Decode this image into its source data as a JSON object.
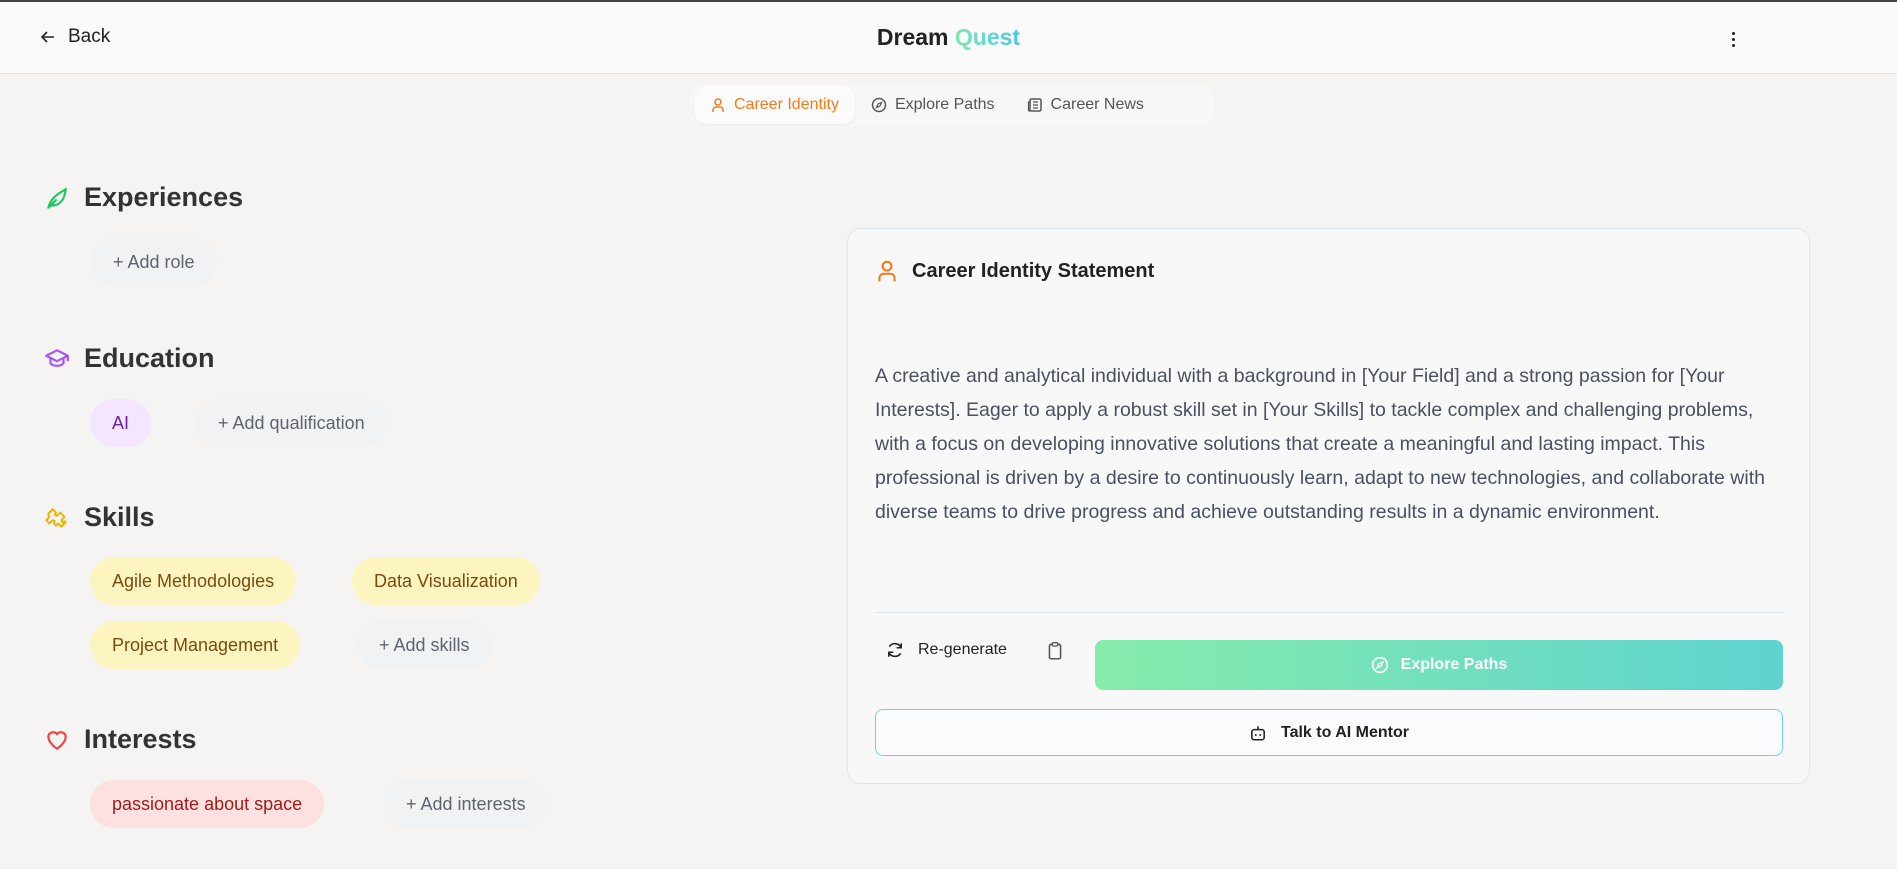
{
  "header": {
    "back_label": "Back",
    "title_part1": "Dream",
    "title_part2": "Quest"
  },
  "tabs": [
    {
      "label": "Career Identity",
      "active": true
    },
    {
      "label": "Explore Paths",
      "active": false
    },
    {
      "label": "Career News",
      "active": false
    }
  ],
  "sections": {
    "experiences": {
      "title": "Experiences",
      "items": [],
      "add_label": "+ Add role"
    },
    "education": {
      "title": "Education",
      "items": [
        "AI"
      ],
      "add_label": "+ Add qualification"
    },
    "skills": {
      "title": "Skills",
      "items": [
        "Agile Methodologies",
        "Data Visualization",
        "Project Management"
      ],
      "add_label": "+ Add skills"
    },
    "interests": {
      "title": "Interests",
      "items": [
        "passionate about space"
      ],
      "add_label": "+ Add interests"
    }
  },
  "card": {
    "title": "Career Identity Statement",
    "statement": "A creative and analytical individual with a background in [Your Field] and a strong passion for [Your Interests]. Eager to apply a robust skill set in [Your Skills] to tackle complex and challenging problems, with a focus on developing innovative solutions that create a meaningful and lasting impact. This professional is driven by a desire to continuously learn, adapt to new technologies, and collaborate with diverse teams to drive progress and achieve outstanding results in a dynamic environment.",
    "regenerate_label": "Re-generate",
    "explore_label": "Explore Paths",
    "mentor_label": "Talk to AI Mentor"
  },
  "colors": {
    "accent_orange": "#f27a1a",
    "green": "#22c55e",
    "purple": "#a855f7",
    "yellow": "#eab308",
    "red": "#ef4444"
  }
}
